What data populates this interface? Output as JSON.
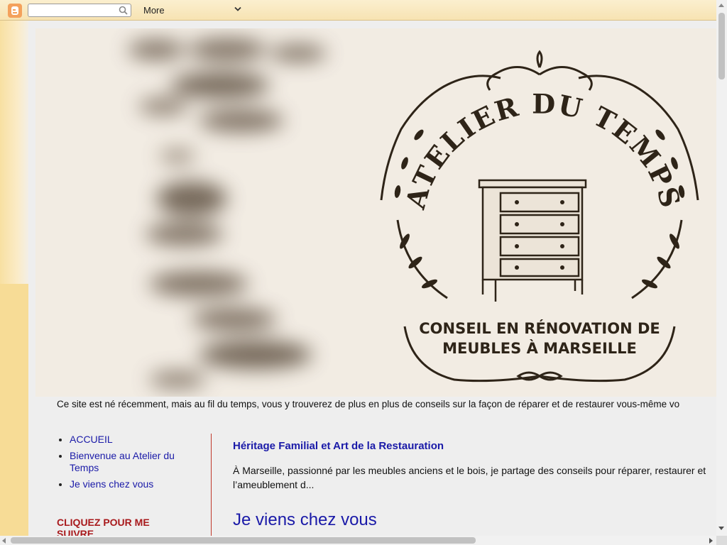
{
  "navbar": {
    "search_value": "",
    "more_label": "More",
    "icons": [
      "blogger-logo-icon",
      "search-icon",
      "chevron-down-icon"
    ]
  },
  "header": {
    "logo_title": "ATELIER DU TEMPS",
    "logo_subtitle_line1": "CONSEIL EN RÉNOVATION DE",
    "logo_subtitle_line2": "MEUBLES À MARSEILLE"
  },
  "description": "Ce site est né récemment, mais au fil du temps, vous y trouverez de plus en plus de conseils sur la façon de réparer et de restaurer vous-même vo",
  "sidebar": {
    "items": [
      {
        "icon": "",
        "label": " ACCUEIL"
      },
      {
        "icon": "",
        "label": "Bienvenue au Atelier du Temps"
      },
      {
        "icon": "",
        "label": " Je viens chez vous"
      }
    ],
    "heading": " CLIQUEZ POUR ME SUIVRE"
  },
  "main": {
    "post_title_small": "Héritage Familial et Art de la Restauration",
    "post_snippet": "À Marseille, passionné par les meubles anciens et le bois, je partage des conseils pour réparer, restaurer et l’ameublement d...",
    "post_title_large": "Je viens chez vous"
  },
  "colors": {
    "link": "#1a1aa8",
    "heading_red": "#a8191c",
    "navbar_bg": "#f7e3b2",
    "body_bg": "#f7dd98",
    "content_bg": "#eeeeee"
  }
}
